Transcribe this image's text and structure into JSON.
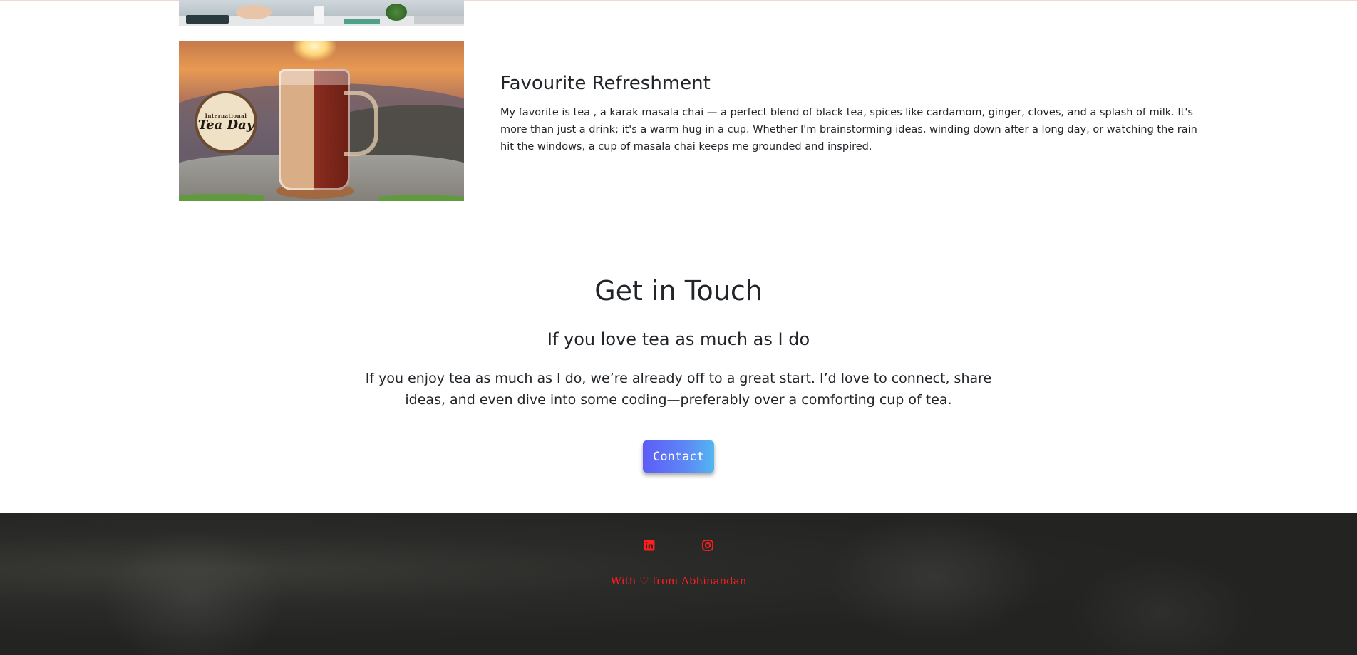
{
  "feature": {
    "title": "Favourite Refreshment",
    "text": "My favorite is tea , a karak masala chai — a perfect blend of black tea, spices like cardamom, ginger, cloves, and a splash of milk. It's more than just a drink; it's a warm hug in a cup. Whether I'm brainstorming ideas, winding down after a long day, or watching the rain hit the windows, a cup of masala chai keeps me grounded and inspired.",
    "image_badge_top": "International",
    "image_badge_main": "Tea Day"
  },
  "contact": {
    "title": "Get in Touch",
    "subtitle": "If you love tea as much as I do",
    "text": "If you enjoy tea as much as I do, we’re already off to a great start. I’d love to connect, share ideas, and even dive into some coding—preferably over a comforting cup of tea.",
    "button_label": "Contact"
  },
  "footer": {
    "text": "With ♡ from Abhinandan",
    "icons": [
      "linkedin-icon",
      "instagram-icon"
    ],
    "accent_color": "#ff1e1e"
  },
  "colors": {
    "button_gradient_start": "#5d5cf6",
    "button_gradient_end": "#53b7f0",
    "footer_bg": "#242422"
  }
}
